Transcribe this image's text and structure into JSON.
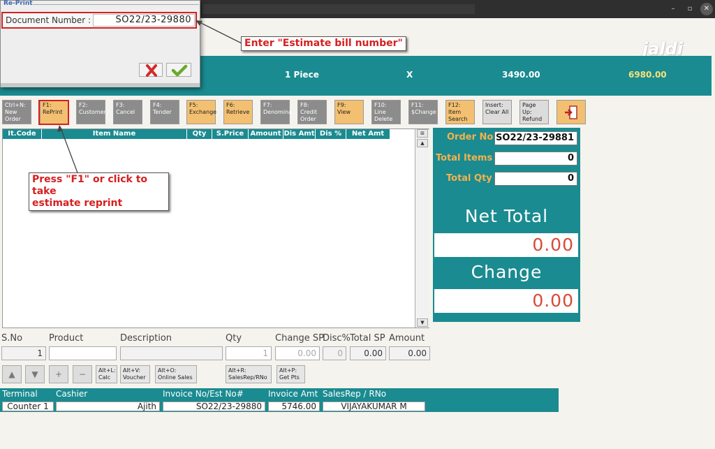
{
  "window": {
    "controls": [
      "–",
      "▫",
      "✕"
    ]
  },
  "watermark": "jaldi",
  "infobar": {
    "pieces": "1 Piece",
    "multiplier": "X",
    "price": "3490.00",
    "total": "6980.00"
  },
  "fkeys": [
    {
      "l1": "Ctrl+N:",
      "l2": "New",
      "l3": "Order"
    },
    {
      "l1": "F1:",
      "l2": "RePrint",
      "l3": ""
    },
    {
      "l1": "F2:",
      "l2": "Customer",
      "l3": ""
    },
    {
      "l1": "F3:",
      "l2": "Cancel",
      "l3": ""
    },
    {
      "l1": "F4:",
      "l2": "Tender",
      "l3": ""
    },
    {
      "l1": "F5:",
      "l2": "Exchange",
      "l3": ""
    },
    {
      "l1": "F6:",
      "l2": "Retrieve",
      "l3": ""
    },
    {
      "l1": "F7:",
      "l2": "Denomina",
      "l3": ""
    },
    {
      "l1": "F8:",
      "l2": "Credit",
      "l3": "Order"
    },
    {
      "l1": "F9:",
      "l2": "View",
      "l3": ""
    },
    {
      "l1": "F10:",
      "l2": "Line",
      "l3": "Delete"
    },
    {
      "l1": "F11:",
      "l2": "$Change",
      "l3": ""
    },
    {
      "l1": "F12:",
      "l2": "Item",
      "l3": "Search"
    },
    {
      "l1": "Insert:",
      "l2": "Clear All",
      "l3": ""
    },
    {
      "l1": "Page Up:",
      "l2": "Refund",
      "l3": ""
    }
  ],
  "grid": {
    "columns": [
      "It.Code",
      "Item Name",
      "Qty",
      "S.Price",
      "Amount",
      "Dis Amt",
      "Dis %",
      "Net Amt"
    ],
    "scroll_up": "▲",
    "scroll_down": "▼"
  },
  "summary": {
    "order_no_label": "Order No",
    "order_no": "SO22/23-29881",
    "total_items_label": "Total Items",
    "total_items": "0",
    "total_qty_label": "Total Qty",
    "total_qty": "0",
    "net_total_label": "Net Total",
    "net_total": "0.00",
    "change_label": "Change",
    "change": "0.00"
  },
  "entry": {
    "labels": [
      "S.No",
      "Product",
      "Description",
      "Qty",
      "Change SP",
      "Disc%",
      "Total SP",
      "Amount"
    ],
    "sno": "1",
    "product": "",
    "description": "",
    "qty": "1",
    "change_sp": "0.00",
    "disc": "0",
    "total_sp": "0.00",
    "amount": "0.00"
  },
  "shortcuts": [
    {
      "l1": "Alt+L:",
      "l2": "Calc"
    },
    {
      "l1": "Alt+V:",
      "l2": "Voucher"
    },
    {
      "l1": "Alt+O:",
      "l2": "Online Sales"
    },
    {
      "l1": "Alt+R:",
      "l2": "SalesRep/RNo"
    },
    {
      "l1": "Alt+P:",
      "l2": "Get Pts"
    }
  ],
  "nav_buttons": [
    "▲",
    "▼",
    "+",
    "−"
  ],
  "bottom": {
    "terminal_label": "Terminal",
    "terminal": "Counter 1",
    "cashier_label": "Cashier",
    "cashier": "Ajith",
    "invoice_label": "Invoice No/Est No#",
    "invoice": "SO22/23-29880",
    "amount_label": "Invoice Amt",
    "amount": "5746.00",
    "salesrep_label": "SalesRep / RNo",
    "salesrep": "VIJAYAKUMAR M"
  },
  "reprint_dialog": {
    "title": "Re-Print",
    "field_label": "Document Number :",
    "field_value": "SO22/23-29880"
  },
  "callouts": {
    "estimate": "Enter \"Estimate bill number\"",
    "f1_line1": "Press \"F1\" or click to take",
    "f1_line2": "estimate reprint"
  },
  "colors": {
    "teal": "#1a8b90",
    "orange_label": "#f5b14c",
    "red_value": "#d64b39",
    "highlight_red": "#d62020"
  }
}
